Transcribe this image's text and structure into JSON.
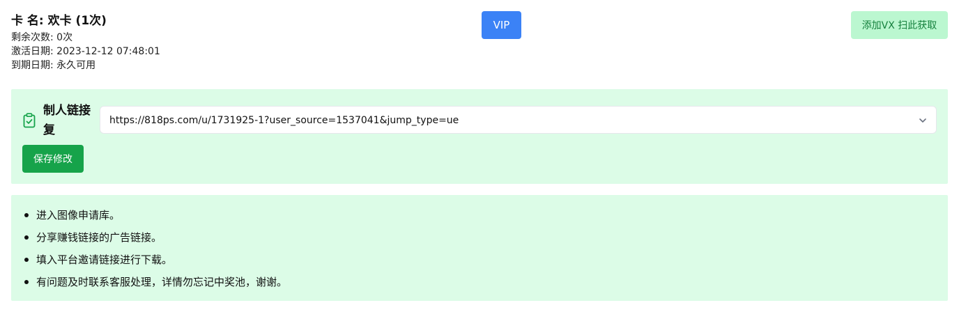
{
  "card": {
    "title": "卡 名: 欢卡 (1次)",
    "remaining": "剩余次数: 0次",
    "activated": "激活日期: 2023-12-12 07:48:01",
    "expires": "到期日期: 永久可用"
  },
  "header": {
    "vip_label": "VIP",
    "add_vx_label": "添加VX 扫此获取"
  },
  "link_form": {
    "label": "制人链接复",
    "selected_link": "https://818ps.com/u/1731925-1?user_source=1537041&jump_type=ue",
    "save_label": "保存修改"
  },
  "notes": [
    "进入图像申请库。",
    "分享赚钱链接的广告链接。",
    "填入平台邀请链接进行下载。",
    "有问题及时联系客服处理，详情勿忘记中奖池，谢谢。"
  ],
  "colors": {
    "vip_button": "#3b82f6",
    "add_vx_button": "#bbf7d0",
    "save_button": "#16a34a",
    "panel_background": "#dcfce7",
    "icon_green": "#16a34a"
  },
  "icons": {
    "link_label_icon": "clipboard-check-icon",
    "select_icon": "chevron-down-icon"
  }
}
